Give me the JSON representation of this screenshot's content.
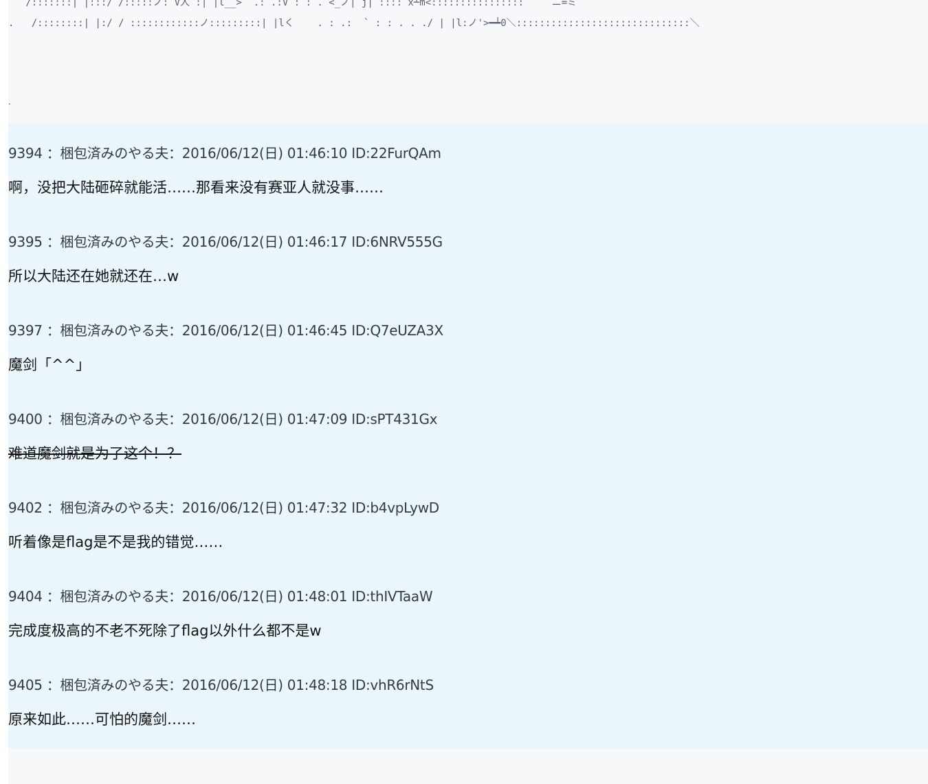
{
  "ascii_art": {
    "line1": "   /:::::::| |:::/ /:::::ノ: V人 :| |l__>  .: .:V : : . <_ノ| j| :::: x┴m<::::::::::::::::   ﾞ ニ=ミ",
    "line2": ".   /::::::::| |:/ / ::::::::::::ノ:::::::::| |lく    . : .:  ` : : . . ./ | |l:ノ'>━┷0＼::::::::::::::::::::::::::::::＼",
    "stray_dot": "."
  },
  "posts": [
    {
      "number": "9394",
      "header": "9394 ：梱包済みのやる夫：2016/06/12(日) 01:46:10 ID:22FurQAm",
      "body": "啊，没把大陆砸碎就能活……那看来没有赛亚人就没事……",
      "strikethrough": false
    },
    {
      "number": "9395",
      "header": "9395 ：梱包済みのやる夫：2016/06/12(日) 01:46:17 ID:6NRV555G",
      "body": "所以大陆还在她就还在…w",
      "strikethrough": false
    },
    {
      "number": "9397",
      "header": "9397 ：梱包済みのやる夫：2016/06/12(日) 01:46:45 ID:Q7eUZA3X",
      "body": "魔剑「^^」",
      "strikethrough": false
    },
    {
      "number": "9400",
      "header": "9400 ：梱包済みのやる夫：2016/06/12(日) 01:47:09 ID:sPT431Gx",
      "body": "难道魔剑就是为了这个！？",
      "strikethrough": true
    },
    {
      "number": "9402",
      "header": "9402 ：梱包済みのやる夫：2016/06/12(日) 01:47:32 ID:b4vpLywD",
      "body": "听着像是flag是不是我的错觉……",
      "strikethrough": false
    },
    {
      "number": "9404",
      "header": "9404 ：梱包済みのやる夫：2016/06/12(日) 01:48:01 ID:thIVTaaW",
      "body": "完成度极高的不老不死除了flag以外什么都不是w",
      "strikethrough": false
    },
    {
      "number": "9405",
      "header": "9405 ：梱包済みのやる夫：2016/06/12(日) 01:48:18 ID:vhR6rNtS",
      "body": "原来如此……可怕的魔剑……",
      "strikethrough": false
    }
  ],
  "colors": {
    "reply_background": "#eaf6fb",
    "top_background": "#f7f8fa",
    "header_text": "#333a44",
    "body_text": "#111111"
  }
}
